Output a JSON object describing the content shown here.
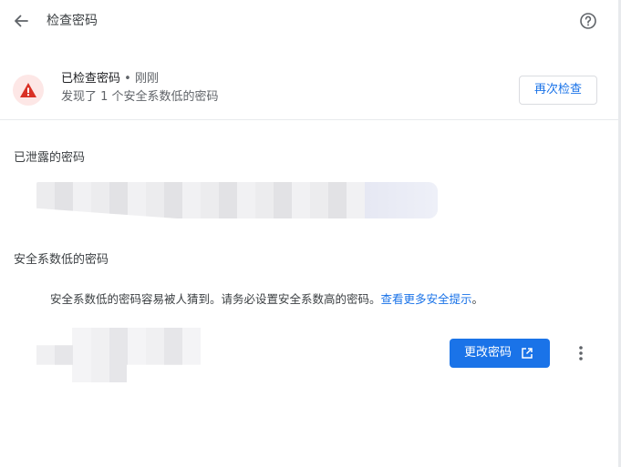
{
  "header": {
    "title": "检查密码",
    "back_icon": "arrow-left-icon",
    "help_icon": "help-circle-icon"
  },
  "status": {
    "icon": "warning-triangle-icon",
    "title_main": "已检查密码",
    "title_dot": " • ",
    "title_time": "刚刚",
    "subtitle": "发现了 1 个安全系数低的密码",
    "recheck_label": "再次检查"
  },
  "leaked": {
    "title": "已泄露的密码"
  },
  "weak": {
    "title": "安全系数低的密码",
    "description": "安全系数低的密码容易被人猜到。请务必设置安全系数高的密码。",
    "link_text": "查看更多安全提示",
    "link_suffix": "。",
    "change_label": "更改密码",
    "external_icon": "open-in-new-icon",
    "more_icon": "more-vert-icon"
  },
  "colors": {
    "accent": "#1a73e8",
    "warning_red": "#d93025",
    "warning_bg": "#fde7e6"
  }
}
